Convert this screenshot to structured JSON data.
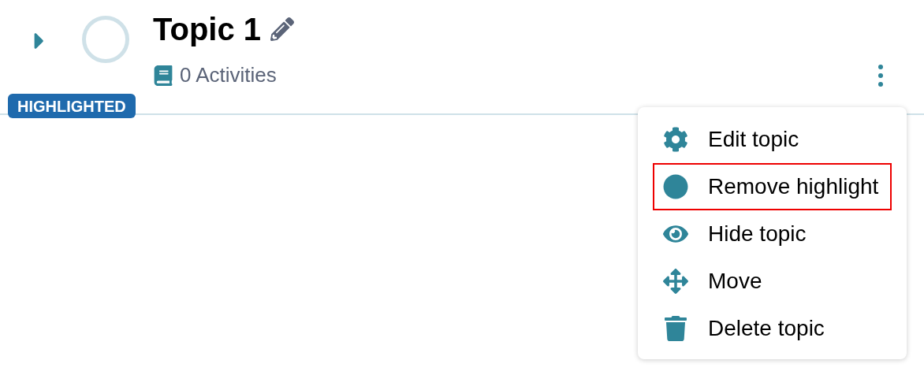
{
  "topic": {
    "title": "Topic 1",
    "activities": "0 Activities",
    "badge": "HIGHLIGHTED",
    "expanded": false
  },
  "menu": {
    "items": [
      {
        "kind": "settings",
        "label": "Edit topic",
        "selected": false
      },
      {
        "kind": "highlight",
        "label": "Remove highlight",
        "selected": true
      },
      {
        "kind": "hide",
        "label": "Hide topic",
        "selected": false
      },
      {
        "kind": "move",
        "label": "Move",
        "selected": false
      },
      {
        "kind": "delete",
        "label": "Delete topic",
        "selected": false
      }
    ]
  }
}
